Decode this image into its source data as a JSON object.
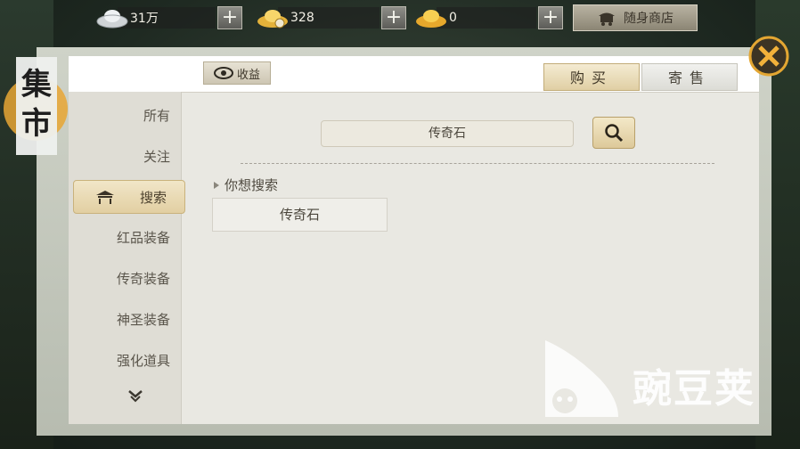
{
  "currencies": [
    {
      "name": "silver",
      "value": "31万",
      "icon": "silver-ingot-icon"
    },
    {
      "name": "gold-bound",
      "value": "328",
      "icon": "gold-bound-ingot-icon"
    },
    {
      "name": "gold",
      "value": "0",
      "icon": "gold-ingot-icon"
    }
  ],
  "plus_label": "+",
  "shop_button": {
    "label": "随身商店",
    "icon": "shop-cart-icon"
  },
  "title": "集市",
  "income_button": {
    "label": "收益",
    "icon": "eye-icon"
  },
  "tabs": [
    {
      "label": "购买",
      "active": true
    },
    {
      "label": "寄售",
      "active": false
    }
  ],
  "sidebar": {
    "items": [
      {
        "label": "所有"
      },
      {
        "label": "关注"
      },
      {
        "label": "搜索",
        "active": true
      },
      {
        "label": "红品装备"
      },
      {
        "label": "传奇装备"
      },
      {
        "label": "神圣装备"
      },
      {
        "label": "强化道具"
      }
    ]
  },
  "search": {
    "value": "传奇石",
    "button_icon": "search-icon"
  },
  "suggestions": {
    "label": "你想搜索",
    "items": [
      {
        "label": "传奇石"
      }
    ]
  },
  "watermark": {
    "text": "豌豆荚"
  },
  "colors": {
    "accent": "#e0cfa4",
    "panel": "#e9e8e2",
    "close": "#e3a632"
  }
}
